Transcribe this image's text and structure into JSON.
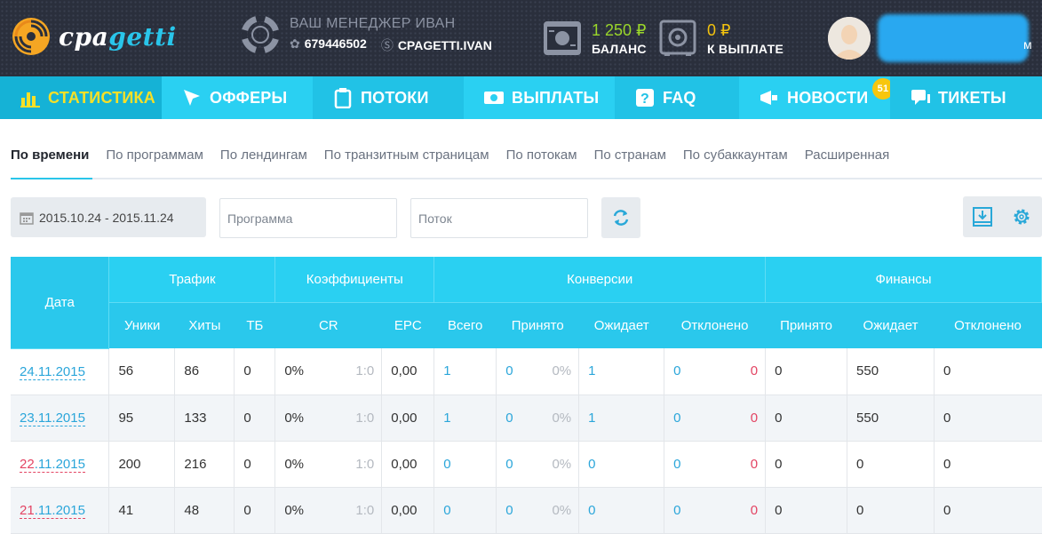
{
  "brand": {
    "name_part1": "cpa",
    "name_part2": "getti"
  },
  "manager": {
    "title": "ВАШ МЕНЕДЖЕР ИВАН",
    "icq": "679446502",
    "skype": "CPAGETTI.IVAN"
  },
  "balance": {
    "value": "1 250 ₽",
    "label": "БАЛАНС"
  },
  "payout": {
    "value": "0 ₽",
    "label": "К ВЫПЛАТЕ"
  },
  "user": {
    "name_tail": "м"
  },
  "nav": {
    "items": [
      {
        "label": "СТАТИСТИКА",
        "icon": "bar-chart-icon"
      },
      {
        "label": "ОФФЕРЫ",
        "icon": "cursor-icon"
      },
      {
        "label": "ПОТОКИ",
        "icon": "clipboard-icon"
      },
      {
        "label": "ВЫПЛАТЫ",
        "icon": "money-icon"
      },
      {
        "label": "FAQ",
        "icon": "question-icon"
      },
      {
        "label": "НОВОСТИ",
        "icon": "megaphone-icon"
      },
      {
        "label": "ТИКЕТЫ",
        "icon": "chat-icon"
      }
    ],
    "news_badge": "51"
  },
  "subtabs": [
    "По времени",
    "По программам",
    "По лендингам",
    "По транзитным страницам",
    "По потокам",
    "По странам",
    "По субаккаунтам",
    "Расширенная"
  ],
  "filters": {
    "date_range": "2015.10.24 - 2015.11.24",
    "program_placeholder": "Программа",
    "stream_placeholder": "Поток"
  },
  "table": {
    "groups": {
      "date": "Дата",
      "traffic": "Трафик",
      "coef": "Коэффициенты",
      "conv": "Конверсии",
      "fin": "Финансы"
    },
    "cols": {
      "uniq": "Уники",
      "hits": "Хиты",
      "tb": "ТБ",
      "cr": "CR",
      "epc": "EPC",
      "total": "Всего",
      "accepted": "Принято",
      "pending": "Ожидает",
      "rejected": "Отклонено",
      "f_accepted": "Принято",
      "f_pending": "Ожидает",
      "f_rejected": "Отклонено"
    },
    "rows": [
      {
        "date_day": "24",
        "date_rest": ".11.2015",
        "uniq": "56",
        "hits": "86",
        "tb": "0",
        "cr": "0%",
        "ratio": "1:0",
        "epc": "0,00",
        "total": "1",
        "accepted": "0",
        "acc_pct": "0%",
        "pending": "1",
        "rejected": "0",
        "rej_n": "0",
        "f_acc": "0",
        "f_pend": "550",
        "f_rej": "0"
      },
      {
        "date_day": "23",
        "date_rest": ".11.2015",
        "uniq": "95",
        "hits": "133",
        "tb": "0",
        "cr": "0%",
        "ratio": "1:0",
        "epc": "0,00",
        "total": "1",
        "accepted": "0",
        "acc_pct": "0%",
        "pending": "1",
        "rejected": "0",
        "rej_n": "0",
        "f_acc": "0",
        "f_pend": "550",
        "f_rej": "0"
      },
      {
        "date_day": "22",
        "date_rest": ".11.2015",
        "uniq": "200",
        "hits": "216",
        "tb": "0",
        "cr": "0%",
        "ratio": "1:0",
        "epc": "0,00",
        "total": "0",
        "accepted": "0",
        "acc_pct": "0%",
        "pending": "0",
        "rejected": "0",
        "rej_n": "0",
        "f_acc": "0",
        "f_pend": "0",
        "f_rej": "0"
      },
      {
        "date_day": "21",
        "date_rest": ".11.2015",
        "uniq": "41",
        "hits": "48",
        "tb": "0",
        "cr": "0%",
        "ratio": "1:0",
        "epc": "0,00",
        "total": "0",
        "accepted": "0",
        "acc_pct": "0%",
        "pending": "0",
        "rejected": "0",
        "rej_n": "0",
        "f_acc": "0",
        "f_pend": "0",
        "f_rej": "0"
      }
    ]
  },
  "colors": {
    "accent": "#2ad0f2",
    "active_nav": "#15b2d6",
    "highlight": "#f7e027",
    "balance": "#9ad62a",
    "payout": "#f2c20e",
    "weekend": "#e34463",
    "link": "#2ba6da"
  }
}
